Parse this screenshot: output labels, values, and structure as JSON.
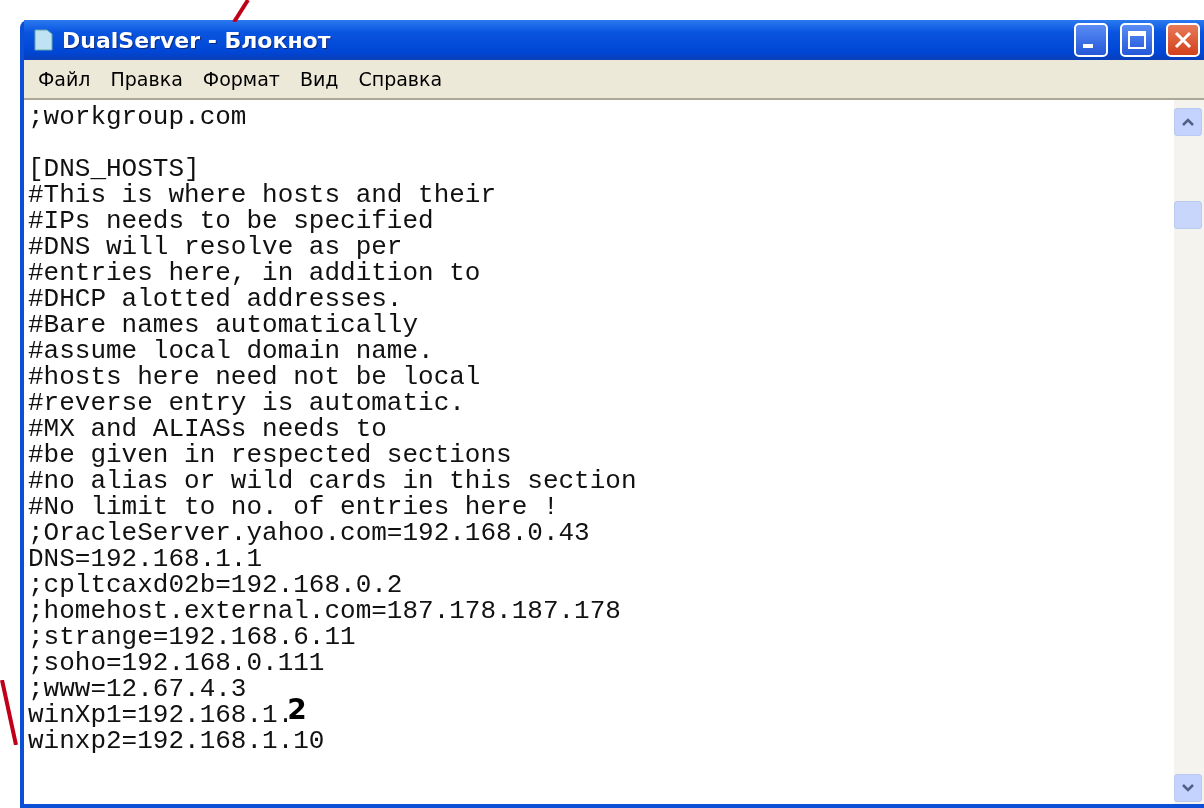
{
  "window": {
    "title": "DualServer - Блокнот"
  },
  "menu": [
    "Файл",
    "Правка",
    "Формат",
    "Вид",
    "Справка"
  ],
  "blocks": [
    {
      "lines": [
        {
          "text": ";workgroup.com"
        }
      ]
    },
    {
      "lines": [
        {
          "text": "[DNS_HOSTS]"
        },
        {
          "text": "#This is where hosts and their"
        },
        {
          "text": "#IPs needs to be specified"
        },
        {
          "text": "#DNS will resolve as per"
        },
        {
          "text": "#entries here, in addition to"
        },
        {
          "text": "#DHCP alotted addresses."
        },
        {
          "text": "#Bare names automatically"
        },
        {
          "text": "#assume local domain name."
        },
        {
          "text": "#hosts here need not be local"
        },
        {
          "text": "#reverse entry is automatic."
        },
        {
          "text": "#MX and ALIASs needs to"
        },
        {
          "text": "#be given in respected sections"
        },
        {
          "text": "#no alias or wild cards in this section"
        },
        {
          "text": "#No limit to no. of entries here !"
        },
        {
          "text": ";OracleServer.yahoo.com=192.168.0.43"
        },
        {
          "text": "DNS=192.168.1.1"
        },
        {
          "text": ";cpltcaxd02b=192.168.0.2"
        },
        {
          "text": ";homehost.external.com=187.178.187.178"
        },
        {
          "text": ";strange=192.168.6.11"
        },
        {
          "text": ";soho=192.168.0.111"
        },
        {
          "text": ";www=12.67.4.3"
        },
        {
          "text": "winXp1=192.168.1.",
          "annotation": "2"
        },
        {
          "text": "winxp2=192.168.1.10"
        }
      ]
    }
  ]
}
